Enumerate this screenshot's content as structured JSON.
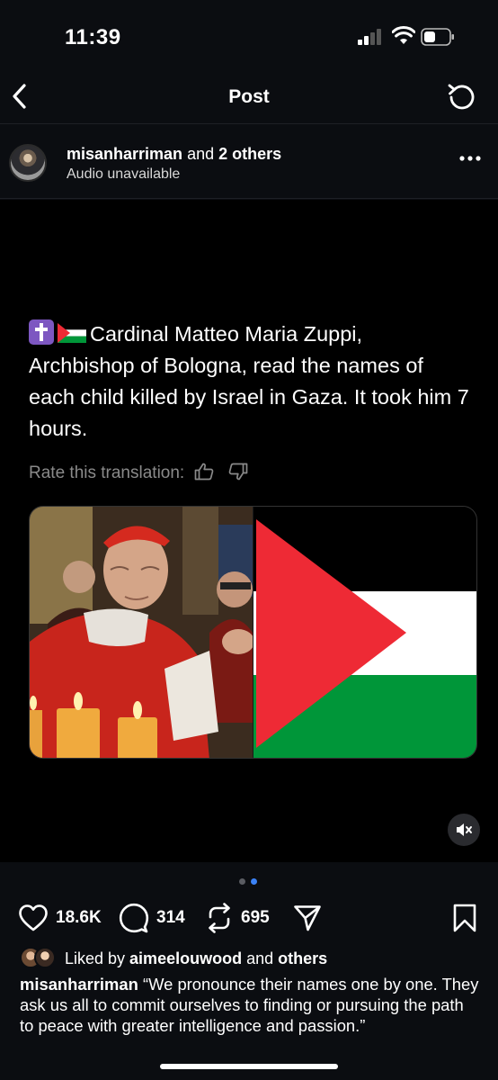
{
  "status_bar": {
    "time": "11:39",
    "icons": [
      "signal-icon",
      "wifi-icon",
      "battery-icon"
    ]
  },
  "nav": {
    "title": "Post",
    "back_icon": "chevron-left-icon",
    "refresh_icon": "refresh-icon"
  },
  "author": {
    "username": "misanharriman",
    "joiner": " and ",
    "others": "2 others",
    "subtitle": "Audio unavailable",
    "menu_icon": "more-horizontal-icon"
  },
  "post": {
    "quote": "Cardinal Matteo Maria Zuppi, Archbishop of Bologna, read the names of each child killed by Israel in Gaza. It took him 7 hours.",
    "rate_label": "Rate this translation:",
    "carousel_total": 2,
    "carousel_active": 2,
    "colors": {
      "flag_red": "#ee2a35",
      "flag_green": "#009639",
      "flag_black": "#000000",
      "flag_white": "#ffffff",
      "cross_purple": "#7d57c1"
    }
  },
  "actions": {
    "likes": "18.6K",
    "comments": "314",
    "reposts": "695"
  },
  "liked_by": {
    "prefix": "Liked by ",
    "user": "aimeelouwood",
    "joiner": " and ",
    "others": "others"
  },
  "caption": {
    "username": "misanharriman",
    "text": " “We pronounce their names one by one. They ask us all to commit ourselves to finding or pursuing the path to peace with greater intelligence and passion.”"
  }
}
